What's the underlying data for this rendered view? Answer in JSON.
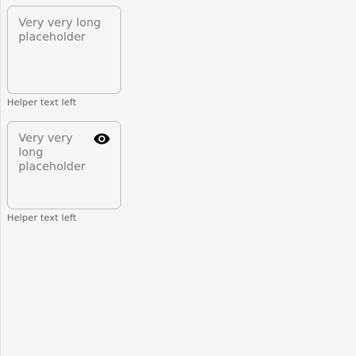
{
  "fields": [
    {
      "placeholder": "Very very long placeholder",
      "value": "",
      "helper": "Helper text left"
    },
    {
      "placeholder": "Very very long placeholder",
      "value": "",
      "helper": "Helper text left",
      "trailing_icon": "eye-icon"
    }
  ]
}
